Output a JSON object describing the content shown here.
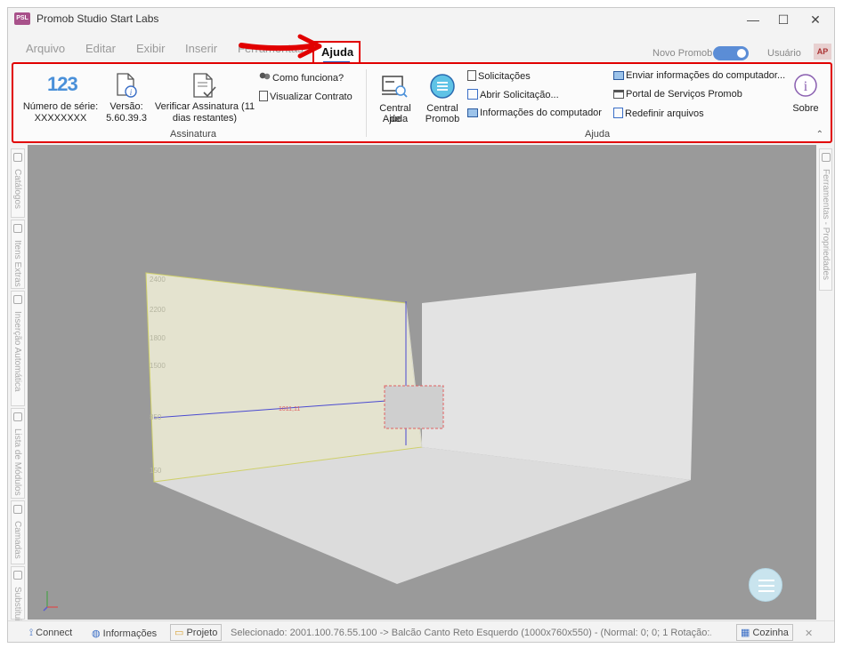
{
  "window": {
    "title": "Promob Studio Start Labs",
    "logo_text": "PSL"
  },
  "window_controls": {
    "minimize": "—",
    "maximize": "☐",
    "close": "✕"
  },
  "menu": {
    "items": [
      "Arquivo",
      "Editar",
      "Exibir",
      "Inserir",
      "Ferramentas",
      "Ajuda"
    ],
    "active": "Ajuda",
    "novo_promob_label": "Novo Promob",
    "novo_promob_on": true,
    "user_label": "Usuário",
    "avatar_initials": "AP"
  },
  "ribbon": {
    "assinatura": {
      "group_label": "Assinatura",
      "serial_number_label": "Número de série:",
      "serial_number_value": "XXXXXXXX",
      "serial_icon_text": "123",
      "version_label": "Versão:",
      "version_value": "5.60.39.3",
      "verify_label_line1": "Verificar Assinatura (11",
      "verify_label_line2": "dias restantes)",
      "how_it_works": "Como funciona?",
      "view_contract": "Visualizar Contrato"
    },
    "ajuda": {
      "group_label": "Ajuda",
      "central_ajuda_line1": "Central de",
      "central_ajuda_line2": "Ajuda",
      "central_promob_line1": "Central",
      "central_promob_line2": "Promob",
      "solicitacoes": "Solicitações",
      "abrir_solicitacao": "Abrir Solicitação...",
      "info_computador": "Informações do computador",
      "enviar_info": "Enviar informações do computador...",
      "portal_servicos": "Portal de Serviços Promob",
      "redefinir_arquivos": "Redefinir arquivos",
      "sobre": "Sobre"
    }
  },
  "left_panel_tabs": [
    "Catálogos",
    "Itens Extras",
    "Inserção Automática",
    "Lista de Módulos",
    "Camadas",
    "Substituir"
  ],
  "right_panel_tabs": [
    "Ferramentas - Propriedades"
  ],
  "viewport": {
    "dimension_labels": [
      "2400",
      "2200",
      "1800",
      "1500",
      "850",
      "150",
      "1011,11"
    ]
  },
  "statusbar": {
    "connect": "Connect",
    "informacoes": "Informações",
    "projeto": "Projeto",
    "selected": "Selecionado: 2001.100.76.55.100 -> Balcão Canto Reto Esquerdo (1000x760x550) - (Normal: 0; 0; 1 Rotação:...",
    "room": "Cozinha",
    "close": "✕"
  }
}
